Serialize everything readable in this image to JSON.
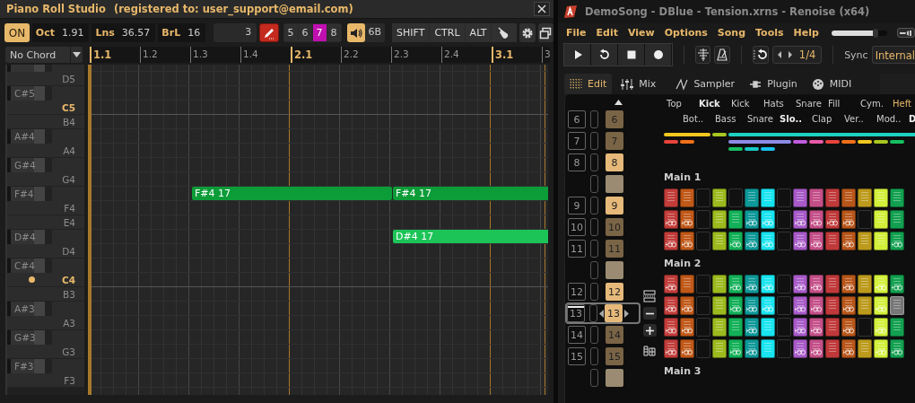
{
  "piano_roll": {
    "title": "Piano Roll Studio",
    "registration": "(registered to: user_support@email.com)",
    "power": {
      "label": "ON",
      "on": true
    },
    "readouts": [
      {
        "label": "Oct",
        "value": "1.91"
      },
      {
        "label": "Lns",
        "value": "36.57"
      },
      {
        "label": "BrL",
        "value": "16"
      }
    ],
    "step": "3",
    "pencil": {
      "on": true
    },
    "grid_sizes": [
      {
        "label": "5",
        "selected": false
      },
      {
        "label": "6",
        "selected": false
      },
      {
        "label": "7",
        "selected": true
      },
      {
        "label": "8",
        "selected": false
      }
    ],
    "audition": {
      "on": true,
      "label": "6B"
    },
    "modifiers": [
      {
        "label": "SHIFT"
      },
      {
        "label": "CTRL"
      },
      {
        "label": "ALT"
      }
    ],
    "chord": "No Chord",
    "ruler": [
      {
        "label": "1.1",
        "kind": "bar"
      },
      {
        "label": "1.2",
        "kind": "beat"
      },
      {
        "label": "1.3",
        "kind": "beat"
      },
      {
        "label": "1.4",
        "kind": "beat"
      },
      {
        "label": "2.1",
        "kind": "bar"
      },
      {
        "label": "2.2",
        "kind": "beat"
      },
      {
        "label": "2.3",
        "kind": "beat"
      },
      {
        "label": "2.4",
        "kind": "beat"
      },
      {
        "label": "3.1",
        "kind": "bar"
      },
      {
        "label": "3",
        "kind": "beat"
      }
    ],
    "keys": [
      {
        "kind": "black"
      },
      {
        "kind": "white",
        "label": "D5"
      },
      {
        "kind": "black",
        "label": "C#5"
      },
      {
        "kind": "root",
        "label": "C5"
      },
      {
        "kind": "white",
        "label": "B4"
      },
      {
        "kind": "black",
        "label": "A#4"
      },
      {
        "kind": "white",
        "label": "A4"
      },
      {
        "kind": "black",
        "label": "G#4"
      },
      {
        "kind": "white",
        "label": "G4"
      },
      {
        "kind": "black",
        "label": "F#4",
        "beats": [
          {
            "kind": "rest"
          },
          {
            "kind": "rest"
          },
          {
            "kind": "note",
            "label": "F#4 17",
            "color": "#0c9c38"
          },
          {
            "kind": "tie"
          },
          {
            "kind": "tie"
          },
          {
            "kind": "tie"
          },
          {
            "kind": "note",
            "label": "F#4 17",
            "color": "#0c9c38"
          },
          {
            "kind": "tie"
          },
          {
            "kind": "tie"
          },
          {
            "kind": "tie"
          }
        ]
      },
      {
        "kind": "white",
        "label": "F4"
      },
      {
        "kind": "white",
        "label": "E4"
      },
      {
        "kind": "black",
        "label": "D#4",
        "beats": [
          {
            "kind": "rest"
          },
          {
            "kind": "rest"
          },
          {
            "kind": "rest"
          },
          {
            "kind": "rest"
          },
          {
            "kind": "rest"
          },
          {
            "kind": "rest"
          },
          {
            "kind": "note",
            "label": "D#4 17",
            "color": "#1cc458"
          },
          {
            "kind": "tie"
          },
          {
            "kind": "tie"
          },
          {
            "kind": "tie"
          }
        ]
      },
      {
        "kind": "white",
        "label": "D4"
      },
      {
        "kind": "black",
        "label": "C#4"
      },
      {
        "kind": "root",
        "label": "C4",
        "marker": true
      },
      {
        "kind": "white",
        "label": "B3"
      },
      {
        "kind": "black",
        "label": "A#3"
      },
      {
        "kind": "white",
        "label": "A3"
      },
      {
        "kind": "black",
        "label": "G#3"
      },
      {
        "kind": "white",
        "label": "G3"
      },
      {
        "kind": "black",
        "label": "F#3"
      },
      {
        "kind": "white",
        "label": "F3"
      }
    ]
  },
  "renoise": {
    "title": "DemoSong - DBlue - Tension.xrns - Renoise (x64)",
    "menu": [
      "File",
      "Edit",
      "View",
      "Options",
      "Song",
      "Tools",
      "Help"
    ],
    "volume": {
      "level": 0.8
    },
    "transport": [
      {
        "kind": "play"
      },
      {
        "kind": "loop"
      },
      {
        "kind": "stop"
      },
      {
        "kind": "record"
      }
    ],
    "lines_per_beat": "1/4",
    "sync": {
      "label": "Sync",
      "value": "Internal"
    },
    "tabs": [
      {
        "label": "Edit",
        "kind": "grid",
        "selected": true
      },
      {
        "label": "Mix",
        "kind": "faders",
        "selected": false
      },
      {
        "label": "Sampler",
        "kind": "wave",
        "selected": false
      },
      {
        "label": "Plugin",
        "kind": "plug",
        "selected": false
      },
      {
        "label": "MIDI",
        "kind": "midi",
        "selected": false
      }
    ],
    "sequence": [
      {
        "index": "6",
        "pattern": "6",
        "color": "#7a6446",
        "selected": false
      },
      {
        "index": "7",
        "pattern": "7",
        "color": "#7a6446",
        "selected": false
      },
      {
        "index": "8",
        "pattern": "8",
        "color": "#e6b97a",
        "selected": false
      },
      {
        "color": "#9a8b72",
        "selected": false
      },
      {
        "index": "9",
        "pattern": "9",
        "color": "#e6b97a",
        "selected": false
      },
      {
        "index": "10",
        "pattern": "10",
        "color": "#7a6446",
        "selected": false
      },
      {
        "index": "11",
        "pattern": "11",
        "color": "#7a6446",
        "selected": false
      },
      {
        "color": "#9a8b72",
        "selected": false
      },
      {
        "index": "12",
        "pattern": "12",
        "color": "#e6b97a",
        "selected": false
      },
      {
        "index": "13",
        "pattern": "13",
        "color": "#e6b97a",
        "selected": true
      },
      {
        "index": "14",
        "pattern": "14",
        "color": "#7a6446",
        "selected": false
      },
      {
        "index": "15",
        "pattern": "15",
        "color": "#7a6446",
        "selected": false
      },
      {
        "color": "#9a8b72",
        "selected": false
      }
    ],
    "tracks": [
      {
        "name": "Top",
        "kind": "track",
        "color": "#c23d3a"
      },
      {
        "name": "Bot..",
        "kind": "track",
        "color": "#c05818"
      },
      {
        "name": "Kick",
        "kind": "group"
      },
      {
        "name": "Bass",
        "kind": "track",
        "color": "#9cba1e"
      },
      {
        "name": "Kick",
        "kind": "track",
        "color": "#12b058"
      },
      {
        "name": "Snare",
        "kind": "track",
        "color": "#0e9898"
      },
      {
        "name": "Hats",
        "kind": "track",
        "color": "#18e4f0"
      },
      {
        "name": "Slo..",
        "kind": "group"
      },
      {
        "name": "Snare",
        "kind": "track",
        "color": "#a85ac8"
      },
      {
        "name": "Clap",
        "kind": "track",
        "color": "#c44f88"
      },
      {
        "name": "Fill",
        "kind": "track",
        "color": "#c0393a"
      },
      {
        "name": "Ver..",
        "kind": "track",
        "color": "#b8561a"
      },
      {
        "name": "Cym.",
        "kind": "track",
        "color": "#bc9a1c"
      },
      {
        "name": "Mod..",
        "kind": "track",
        "color": "#d2f03a"
      },
      {
        "name": "Heft",
        "kind": "accent",
        "color": "#12a050"
      },
      {
        "name": "D",
        "kind": "group"
      }
    ],
    "group_bars": [
      [
        {
          "kind": "bar",
          "color": "#f2c81e"
        },
        {
          "kind": "bar",
          "color": "#f2c81e"
        },
        {
          "kind": "bar",
          "color": "#f2c81e"
        },
        {
          "kind": "bar",
          "color": "#a8c820"
        },
        {
          "kind": "bar",
          "color": "#1ed0c0"
        },
        {
          "kind": "bar",
          "color": "#1ed0c0"
        },
        {
          "kind": "bar",
          "color": "#1ed0c0"
        },
        {
          "kind": "bar",
          "color": "#1ed0c0"
        },
        {
          "kind": "bar",
          "color": "#1ed0c0"
        },
        {
          "kind": "bar",
          "color": "#1ed0c0"
        },
        {
          "kind": "bar",
          "color": "#1ed0c0"
        },
        {
          "kind": "bar",
          "color": "#1ed0c0"
        },
        {
          "kind": "bar",
          "color": "#1ed0c0"
        },
        {
          "kind": "bar",
          "color": "#1ed0c0"
        },
        {
          "kind": "bar",
          "color": "#1ed0c0"
        },
        {
          "kind": "bar",
          "color": "#1ed0c0"
        }
      ],
      [
        {
          "kind": "bar",
          "color": "#e8443c"
        },
        {
          "kind": "bar",
          "color": "#f0701c"
        },
        {
          "kind": "gap"
        },
        {
          "kind": "gap"
        },
        {
          "kind": "bar",
          "color": "#8c8ce8"
        },
        {
          "kind": "bar",
          "color": "#8c8ce8"
        },
        {
          "kind": "bar",
          "color": "#8c8ce8"
        },
        {
          "kind": "bar",
          "color": "#8c8ce8"
        },
        {
          "kind": "bar",
          "color": "#c05ae0"
        },
        {
          "kind": "bar",
          "color": "#e85aa8"
        },
        {
          "kind": "bar",
          "color": "#e8443c"
        },
        {
          "kind": "bar",
          "color": "#f0701c"
        },
        {
          "kind": "bar",
          "color": "#f2c81e"
        },
        {
          "kind": "bar",
          "color": "#a8c820"
        },
        {
          "kind": "bar",
          "color": "#16c060"
        }
      ],
      [
        {
          "kind": "gap"
        },
        {
          "kind": "gap"
        },
        {
          "kind": "gap"
        },
        {
          "kind": "gap"
        },
        {
          "kind": "bar",
          "color": "#16c060"
        },
        {
          "kind": "bar",
          "color": "#18c8c8"
        },
        {
          "kind": "bar",
          "color": "#18c0f0"
        }
      ]
    ],
    "sections": [
      {
        "title": "Main 1",
        "rows": [
          [
            {
              "kind": "filled"
            },
            {
              "kind": "filled"
            },
            {
              "kind": "empty"
            },
            {
              "kind": "filled"
            },
            {
              "kind": "empty"
            },
            {
              "kind": "filled"
            },
            {
              "kind": "filled"
            },
            {
              "kind": "empty"
            },
            {
              "kind": "filled"
            },
            {
              "kind": "filled"
            },
            {
              "kind": "filled"
            },
            {
              "kind": "filled"
            },
            {
              "kind": "filled"
            },
            {
              "kind": "filled"
            },
            {
              "kind": "filled"
            }
          ],
          [
            {
              "kind": "alias"
            },
            {
              "kind": "alias"
            },
            {
              "kind": "empty"
            },
            {
              "kind": "filled"
            },
            {
              "kind": "filled"
            },
            {
              "kind": "alias"
            },
            {
              "kind": "alias"
            },
            {
              "kind": "empty"
            },
            {
              "kind": "alias"
            },
            {
              "kind": "alias"
            },
            {
              "kind": "alias"
            },
            {
              "kind": "alias"
            },
            {
              "kind": "empty"
            },
            {
              "kind": "filled"
            },
            {
              "kind": "filled"
            }
          ],
          [
            {
              "kind": "alias"
            },
            {
              "kind": "alias"
            },
            {
              "kind": "empty"
            },
            {
              "kind": "filled"
            },
            {
              "kind": "alias"
            },
            {
              "kind": "alias"
            },
            {
              "kind": "alias"
            },
            {
              "kind": "empty"
            },
            {
              "kind": "alias"
            },
            {
              "kind": "alias"
            },
            {
              "kind": "filled"
            },
            {
              "kind": "alias"
            },
            {
              "kind": "filled"
            },
            {
              "kind": "filled"
            },
            {
              "kind": "alias"
            }
          ]
        ]
      },
      {
        "title": "Main 2",
        "rows": [
          [
            {
              "kind": "alias"
            },
            {
              "kind": "filled"
            },
            {
              "kind": "empty"
            },
            {
              "kind": "filled"
            },
            {
              "kind": "alias"
            },
            {
              "kind": "alias"
            },
            {
              "kind": "alias"
            },
            {
              "kind": "empty"
            },
            {
              "kind": "alias"
            },
            {
              "kind": "alias"
            },
            {
              "kind": "filled"
            },
            {
              "kind": "alias"
            },
            {
              "kind": "filled"
            },
            {
              "kind": "alias"
            },
            {
              "kind": "alias"
            }
          ],
          [
            {
              "kind": "alias"
            },
            {
              "kind": "alias"
            },
            {
              "kind": "empty"
            },
            {
              "kind": "filled"
            },
            {
              "kind": "alias"
            },
            {
              "kind": "alias"
            },
            {
              "kind": "alias"
            },
            {
              "kind": "empty"
            },
            {
              "kind": "alias"
            },
            {
              "kind": "alias"
            },
            {
              "kind": "filled"
            },
            {
              "kind": "alias"
            },
            {
              "kind": "filled"
            },
            {
              "kind": "alias"
            },
            {
              "kind": "muted"
            }
          ],
          [
            {
              "kind": "alias"
            },
            {
              "kind": "alias"
            },
            {
              "kind": "empty"
            },
            {
              "kind": "filled"
            },
            {
              "kind": "filled"
            },
            {
              "kind": "alias"
            },
            {
              "kind": "filled"
            },
            {
              "kind": "empty"
            },
            {
              "kind": "alias"
            },
            {
              "kind": "alias"
            },
            {
              "kind": "filled"
            },
            {
              "kind": "alias"
            },
            {
              "kind": "empty"
            },
            {
              "kind": "alias"
            },
            {
              "kind": "filled"
            }
          ],
          [
            {
              "kind": "alias"
            },
            {
              "kind": "alias"
            },
            {
              "kind": "empty"
            },
            {
              "kind": "filled"
            },
            {
              "kind": "alias"
            },
            {
              "kind": "alias"
            },
            {
              "kind": "filled"
            },
            {
              "kind": "empty"
            },
            {
              "kind": "alias"
            },
            {
              "kind": "alias"
            },
            {
              "kind": "filled"
            },
            {
              "kind": "alias"
            },
            {
              "kind": "filled"
            },
            {
              "kind": "alias"
            },
            {
              "kind": "alias"
            }
          ]
        ]
      },
      {
        "title": "Main 3"
      }
    ]
  }
}
